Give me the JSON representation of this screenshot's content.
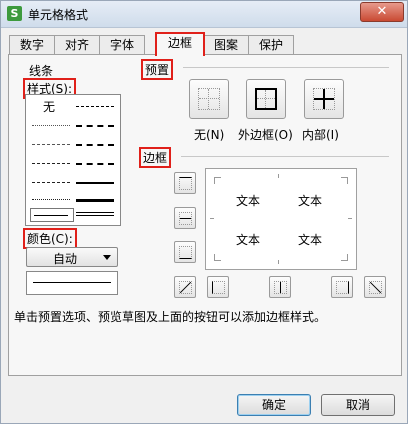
{
  "window": {
    "title": "单元格格式",
    "close_label": "✕",
    "icon_label": "S"
  },
  "tabs": [
    {
      "label": "数字"
    },
    {
      "label": "对齐"
    },
    {
      "label": "字体"
    },
    {
      "label": "边框",
      "active": true
    },
    {
      "label": "图案"
    },
    {
      "label": "保护"
    }
  ],
  "line_group": {
    "title": "线条",
    "style_label": "样式(S):",
    "none_label": "无",
    "color_label": "颜色(C):",
    "color_value": "自动"
  },
  "preset_group": {
    "title": "预置",
    "buttons": [
      {
        "label": "无(N)"
      },
      {
        "label": "外边框(O)"
      },
      {
        "label": "内部(I)"
      }
    ]
  },
  "border_group": {
    "title": "边框",
    "preview_text": [
      "文本",
      "文本",
      "文本",
      "文本"
    ]
  },
  "hint": "单击预置选项、预览草图及上面的按钮可以添加边框样式。",
  "buttons": {
    "ok": "确定",
    "cancel": "取消"
  },
  "colors": {
    "highlight": "#e0201a",
    "title_bar": "#cfdceb"
  }
}
